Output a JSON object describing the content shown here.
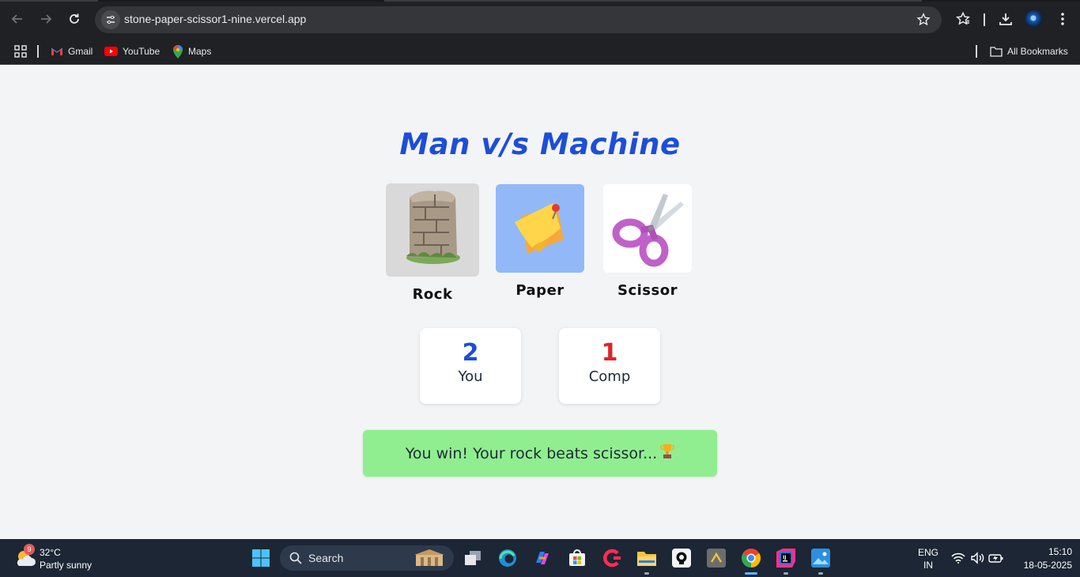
{
  "browser": {
    "url": "stone-paper-scissor1-nine.vercel.app",
    "bookmarks": [
      {
        "label": "Gmail",
        "icon": "gmail-icon"
      },
      {
        "label": "YouTube",
        "icon": "youtube-icon"
      },
      {
        "label": "Maps",
        "icon": "maps-icon"
      }
    ],
    "all_bookmarks_label": "All Bookmarks"
  },
  "game": {
    "title": "Man v/s Machine",
    "choices": [
      {
        "label": "Rock",
        "icon": "rock-icon",
        "bg": "#d9d9d9"
      },
      {
        "label": "Paper",
        "icon": "paper-icon",
        "bg": "#93b8f8"
      },
      {
        "label": "Scissor",
        "icon": "scissor-icon",
        "bg": "#ffffff"
      }
    ],
    "scores": {
      "user": {
        "value": "2",
        "label": "You",
        "color": "#1d4ed8"
      },
      "comp": {
        "value": "1",
        "label": "Comp",
        "color": "#dc2626"
      }
    },
    "message": "You win! Your rock beats scissor...",
    "message_icon": "trophy-icon",
    "message_bg": "#90ee90"
  },
  "taskbar": {
    "weather": {
      "badge": "9",
      "temp": "32°C",
      "condition": "Partly sunny"
    },
    "search_label": "Search",
    "language": {
      "line1": "ENG",
      "line2": "IN"
    },
    "clock": {
      "time": "15:10",
      "date": "18-05-2025"
    }
  }
}
